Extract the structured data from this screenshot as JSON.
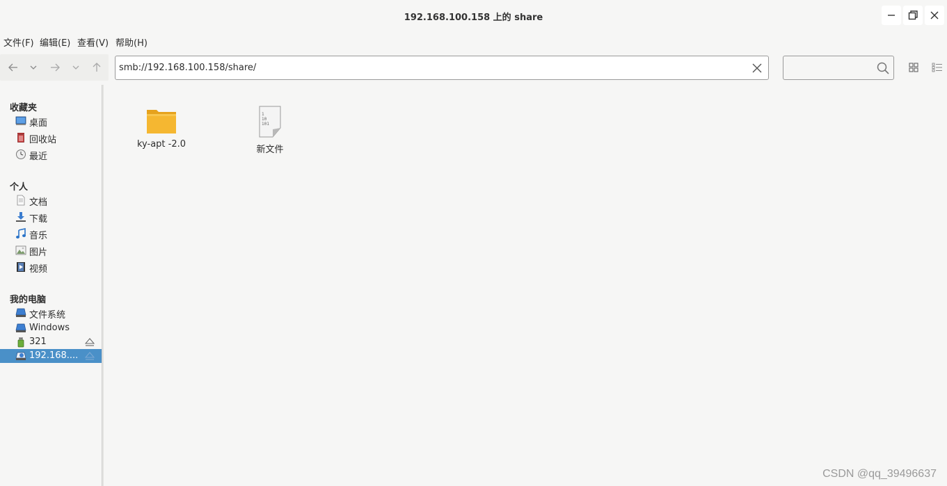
{
  "window": {
    "title": "192.168.100.158 上的 share",
    "minimize_icon": "minimize-icon",
    "maximize_icon": "maximize-icon",
    "close_icon": "close-icon"
  },
  "menu": [
    "文件(F)",
    "编辑(E)",
    "查看(V)",
    "帮助(H)"
  ],
  "toolbar": {
    "back_icon": "arrow-left-icon",
    "back_history_icon": "chevron-down-icon",
    "forward_icon": "arrow-right-icon",
    "forward_history_icon": "chevron-down-icon",
    "up_icon": "arrow-up-icon",
    "path": "smb://192.168.100.158/share/",
    "search_value": "",
    "view_icons": [
      "icon-view-icon",
      "list-view-icon"
    ]
  },
  "sidebar": {
    "sections": [
      {
        "title": "收藏夹",
        "items": [
          {
            "label": "桌面",
            "icon": "desktop-icon"
          },
          {
            "label": "回收站",
            "icon": "trash-icon"
          },
          {
            "label": "最近",
            "icon": "recent-icon"
          }
        ]
      },
      {
        "title": "个人",
        "items": [
          {
            "label": "文档",
            "icon": "document-icon"
          },
          {
            "label": "下载",
            "icon": "download-icon"
          },
          {
            "label": "音乐",
            "icon": "music-icon"
          },
          {
            "label": "图片",
            "icon": "picture-icon"
          },
          {
            "label": "视频",
            "icon": "video-icon"
          }
        ]
      },
      {
        "title": "我的电脑",
        "items": [
          {
            "label": "文件系统",
            "icon": "drive-icon"
          },
          {
            "label": "Windows",
            "icon": "drive-icon"
          },
          {
            "label": "321",
            "icon": "usb-icon",
            "eject": true
          },
          {
            "label": "192.168....",
            "icon": "network-share-icon",
            "eject": true,
            "selected": true
          }
        ]
      }
    ]
  },
  "files": [
    {
      "name": "ky-apt -2.0",
      "icon": "folder-icon"
    },
    {
      "name": "新文件",
      "icon": "binary-file-icon"
    }
  ],
  "watermark": "CSDN @qq_39496637",
  "colors": {
    "selection": "#4a90c8",
    "folder": "#f5b731",
    "background": "#f6f6f5"
  }
}
